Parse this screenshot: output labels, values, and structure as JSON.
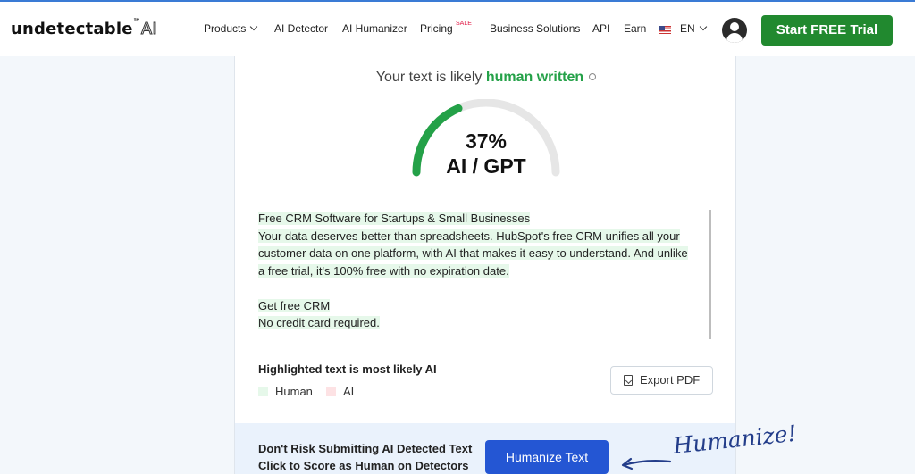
{
  "brand": {
    "name": "undetectable",
    "tm": "™",
    "suffix": "AI"
  },
  "nav": {
    "items": [
      {
        "label": "Products",
        "has_dropdown": true
      },
      {
        "label": "AI Detector"
      },
      {
        "label": "AI Humanizer"
      },
      {
        "label": "Pricing",
        "badge": "SALE"
      },
      {
        "label": "Business Solutions"
      },
      {
        "label": "API"
      },
      {
        "label": "Earn"
      }
    ],
    "language": "EN",
    "cta": "Start FREE Trial"
  },
  "result": {
    "prefix": "Your text is likely",
    "verdict": "human written",
    "percent_text": "37%",
    "percent_value": 37,
    "gauge_label": "AI / GPT"
  },
  "analyzed_text": {
    "title": "Free CRM Software for Startups & Small Businesses",
    "paragraph": [
      "Your data deserves better than spreadsheets. HubSpot's free CRM unifies all your",
      "customer data on one platform, with AI that makes it easy to understand. And unlike",
      "a free trial, it's 100% free with no expiration date."
    ],
    "line_cta": "Get free CRM",
    "line_note": "No credit card required."
  },
  "legend": {
    "title": "Highlighted text is most likely AI",
    "human": "Human",
    "ai": "AI",
    "human_color": "#e6f8ea",
    "ai_color": "#fde2e4"
  },
  "export_label": "Export PDF",
  "banner": {
    "line1": "Don't Risk Submitting AI Detected Text",
    "line2": "Click to Score as Human on Detectors",
    "button": "Humanize Text",
    "annotation": "Humanize!"
  },
  "colors": {
    "accent_green": "#24a148",
    "cta_green": "#21892f",
    "primary_blue": "#2456d3",
    "gauge_track": "#e6e6e6"
  }
}
